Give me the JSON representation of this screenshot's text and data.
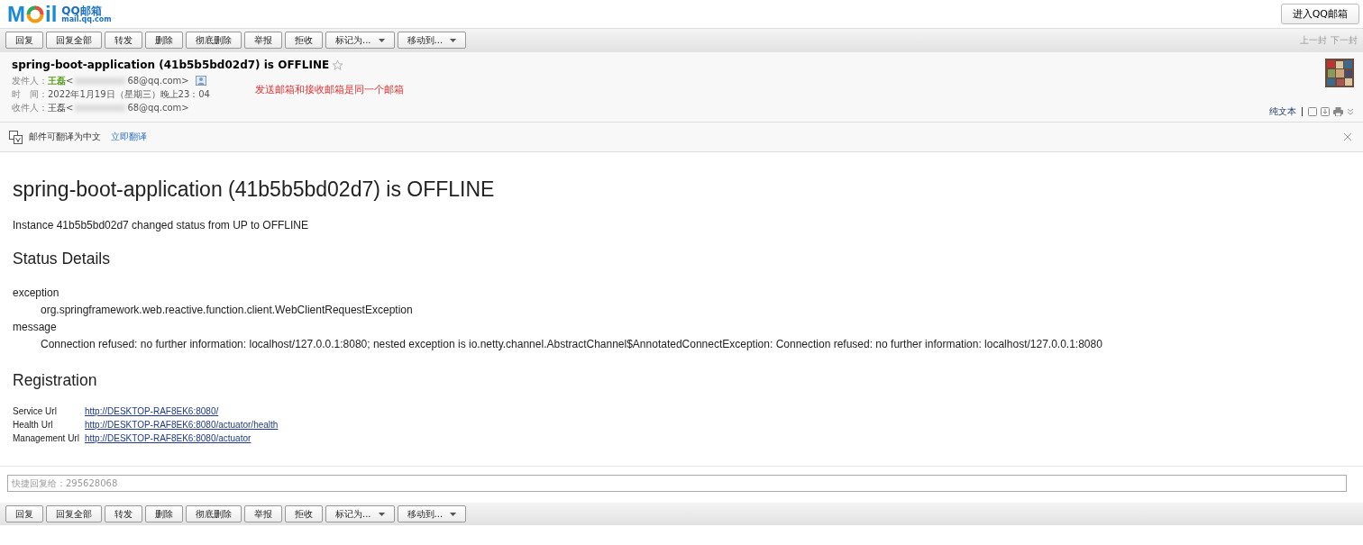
{
  "logo": {
    "first": "M",
    "rest": "il",
    "brand": "QQ邮箱",
    "domain": "mail.qq.com"
  },
  "enter_button": "进入QQ邮箱",
  "toolbar": [
    {
      "label": "回复",
      "kind": "plain"
    },
    {
      "label": "回复全部",
      "kind": "plain"
    },
    {
      "label": "转发",
      "kind": "plain"
    },
    {
      "label": "删除",
      "kind": "plain"
    },
    {
      "label": "彻底删除",
      "kind": "plain"
    },
    {
      "label": "举报",
      "kind": "plain"
    },
    {
      "label": "拒收",
      "kind": "plain"
    },
    {
      "label": "标记为...",
      "kind": "menu"
    },
    {
      "label": "移动到...",
      "kind": "menu"
    }
  ],
  "bottom_toolbar": [
    {
      "label": "回复",
      "kind": "plain"
    },
    {
      "label": "回复全部",
      "kind": "plain"
    },
    {
      "label": "转发",
      "kind": "plain"
    },
    {
      "label": "删除",
      "kind": "plain"
    },
    {
      "label": "彻底删除",
      "kind": "plain"
    },
    {
      "label": "举报",
      "kind": "plain"
    },
    {
      "label": "拒收",
      "kind": "plain"
    },
    {
      "label": "标记为...",
      "kind": "menu"
    },
    {
      "label": "移动到...",
      "kind": "menu"
    }
  ],
  "nav": [
    "上一封",
    "下一封"
  ],
  "header": {
    "subject": "spring-boot-application (41b5b5bd02d7) is OFFLINE",
    "starred": false,
    "from": {
      "label": "发件人：",
      "name": "王磊",
      "email_start": "<",
      "email_end": "68@qq.com>"
    },
    "time": {
      "label": "时　间：",
      "value": "2022年1月19日（星期三）晚上23：04"
    },
    "to": {
      "label": "收件人：",
      "name": "王磊",
      "email_start": "<",
      "email_end": "68@qq.com>"
    },
    "note": "发送邮箱和接收邮箱是同一个邮箱",
    "plain_text": "纯文本"
  },
  "translate": {
    "text": "邮件可翻译为中文",
    "link": "立即翻译"
  },
  "body": {
    "title": "spring-boot-application (41b5b5bd02d7) is OFFLINE",
    "intro": "Instance 41b5b5bd02d7 changed status from UP to OFFLINE",
    "details_heading": "Status Details",
    "details": [
      {
        "term": "exception",
        "value": "org.springframework.web.reactive.function.client.WebClientRequestException"
      },
      {
        "term": "message",
        "value": "Connection refused: no further information: localhost/127.0.0.1:8080; nested exception is io.netty.channel.AbstractChannel$AnnotatedConnectException: Connection refused: no further information: localhost/127.0.0.1:8080"
      }
    ],
    "registration_heading": "Registration",
    "registration": [
      {
        "label": "Service Url",
        "url": "http://DESKTOP-RAF8EK6:8080/"
      },
      {
        "label": "Health Url",
        "url": "http://DESKTOP-RAF8EK6:8080/actuator/health"
      },
      {
        "label": "Management Url",
        "url": "http://DESKTOP-RAF8EK6:8080/actuator"
      }
    ]
  },
  "quick_reply": {
    "placeholder": "快捷回复给：295628068"
  }
}
